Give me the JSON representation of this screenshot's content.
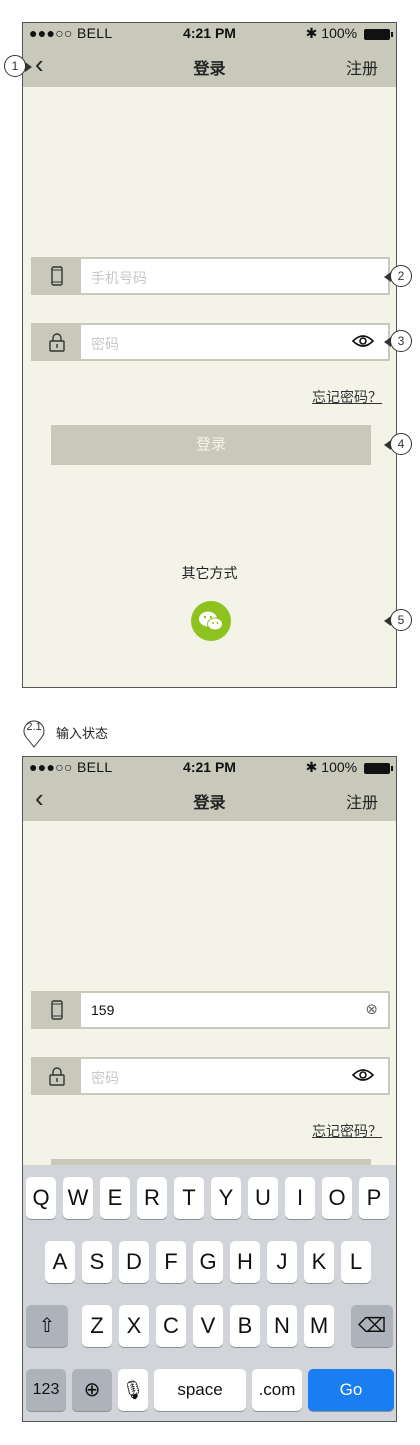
{
  "status_bar": {
    "carrier": "●●●○○ BELL",
    "time": "4:21 PM",
    "battery": "100%"
  },
  "nav": {
    "back_icon": "‹",
    "title": "登录",
    "register": "注册"
  },
  "login_form": {
    "phone_placeholder": "手机号码",
    "password_placeholder": "密码",
    "forgot_password": "忘记密码？",
    "login_button": "登录"
  },
  "other_methods": {
    "label": "其它方式",
    "wechat_icon": "wechat-icon"
  },
  "annotations": {
    "m1": "1",
    "m2": "2",
    "m3": "3",
    "m4": "4",
    "m5": "5",
    "m21": "2.1"
  },
  "section2": {
    "label": "输入状态",
    "phone_value": "159"
  },
  "keyboard": {
    "row1": [
      "Q",
      "W",
      "E",
      "R",
      "T",
      "Y",
      "U",
      "I",
      "O",
      "P"
    ],
    "row2": [
      "A",
      "S",
      "D",
      "F",
      "G",
      "H",
      "J",
      "K",
      "L"
    ],
    "row3": [
      "Z",
      "X",
      "C",
      "V",
      "B",
      "N",
      "M"
    ],
    "numbers_key": "123",
    "space_key": "space",
    "dotcom_key": ".com",
    "go_key": "Go"
  },
  "colors": {
    "bar": "#c9c9bb",
    "background": "#f3f3e8",
    "wechat": "#8dc21f",
    "go_button": "#1a7ef3"
  }
}
